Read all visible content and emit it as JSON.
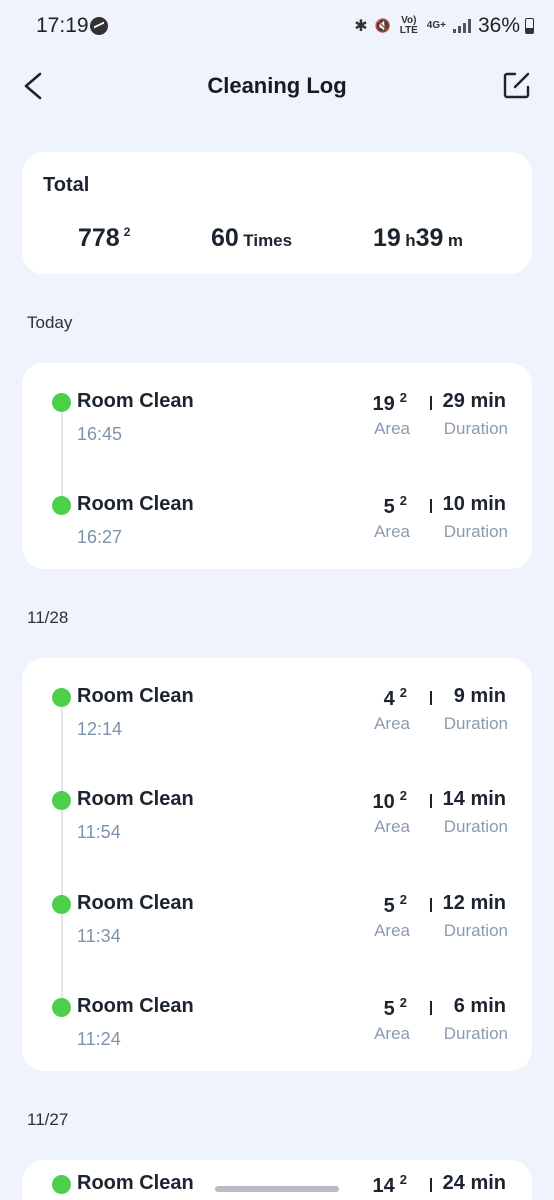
{
  "status_bar": {
    "time": "17:19",
    "network": "Vo) LTE",
    "network_gen": "4G+",
    "battery": "36%"
  },
  "header": {
    "title": "Cleaning Log"
  },
  "total": {
    "label": "Total",
    "area_value": "778",
    "area_unit": "2",
    "times_value": "60",
    "times_unit": "Times",
    "hours": "19",
    "hours_unit": "h",
    "minutes": "39",
    "minutes_unit": "m"
  },
  "labels": {
    "area": "Area",
    "duration": "Duration",
    "sup": "2"
  },
  "sections": [
    {
      "date": "Today",
      "entries": [
        {
          "title": "Room Clean",
          "time": "16:45",
          "area": "19",
          "duration": "29 min"
        },
        {
          "title": "Room Clean",
          "time": "16:27",
          "area": "5",
          "duration": "10 min"
        }
      ]
    },
    {
      "date": "11/28",
      "entries": [
        {
          "title": "Room Clean",
          "time": "12:14",
          "area": "4",
          "duration": "9 min"
        },
        {
          "title": "Room Clean",
          "time": "11:54",
          "area": "10",
          "duration": "14 min"
        },
        {
          "title": "Room Clean",
          "time": "11:34",
          "area": "5",
          "duration": "12 min"
        },
        {
          "title": "Room Clean",
          "time": "11:24",
          "area": "5",
          "duration": "6 min"
        }
      ]
    },
    {
      "date": "11/27",
      "entries": [
        {
          "title": "Room Clean",
          "time": "",
          "area": "14",
          "duration": "24 min"
        }
      ]
    }
  ],
  "colors": {
    "background": "#eef3fc",
    "dot_green": "#4cd04a",
    "secondary_text": "#7e93ab"
  }
}
